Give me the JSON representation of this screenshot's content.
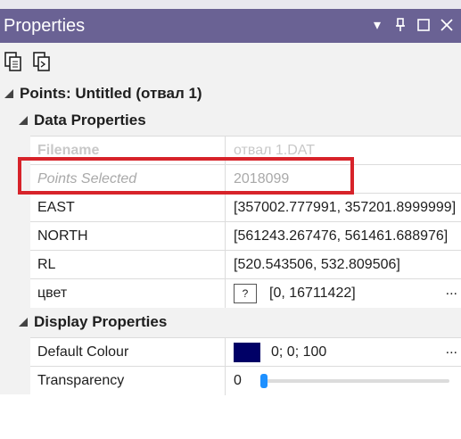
{
  "window": {
    "title": "Properties"
  },
  "title_controls": [
    {
      "name": "dropdown-icon",
      "glyph": "▾"
    },
    {
      "name": "pin-icon",
      "glyph": "⇩"
    },
    {
      "name": "maximize-icon",
      "glyph": "☐"
    },
    {
      "name": "close-icon",
      "glyph": "✕"
    }
  ],
  "toolbar": {
    "copy_icon": "copy-icon",
    "paste_icon": "paste-icon"
  },
  "object": {
    "header": "Points: Untitled (отвал 1)"
  },
  "data_properties": {
    "header": "Data Properties",
    "rows": [
      {
        "name": "Filename",
        "value": "отвал 1.DAT"
      },
      {
        "name": "Points Selected",
        "value": "2018099"
      },
      {
        "name": "EAST",
        "value": "[357002.777991, 357201.8999999]"
      },
      {
        "name": "NORTH",
        "value": "[561243.267476, 561461.688976]"
      },
      {
        "name": "RL",
        "value": "[520.543506, 532.809506]"
      },
      {
        "name": "цвет",
        "value": "[0, 16711422]",
        "qbox": "?",
        "ellipsis": "..."
      }
    ]
  },
  "display_properties": {
    "header": "Display Properties",
    "rows": [
      {
        "name": "Default Colour",
        "value": "0; 0; 100",
        "color": "#000066",
        "ellipsis": "..."
      },
      {
        "name": "Transparency",
        "value": "0",
        "slider_value": 0
      }
    ]
  },
  "colors": {
    "titlebar": "#6a6294",
    "highlight": "#d7232a",
    "slider": "#1e90ff"
  }
}
